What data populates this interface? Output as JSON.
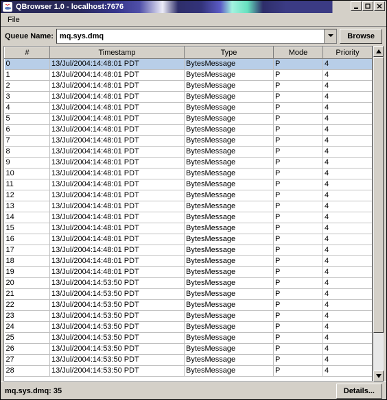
{
  "window": {
    "title": "QBrowser 1.0 - localhost:7676"
  },
  "menu": {
    "file": "File"
  },
  "toolbar": {
    "queue_label": "Queue Name:",
    "queue_value": "mq.sys.dmq",
    "browse_label": "Browse"
  },
  "columns": {
    "num": "#",
    "timestamp": "Timestamp",
    "type": "Type",
    "mode": "Mode",
    "priority": "Priority"
  },
  "rows": [
    {
      "n": "0",
      "ts": "13/Jul/2004:14:48:01 PDT",
      "type": "BytesMessage",
      "mode": "P",
      "prio": "4",
      "sel": true
    },
    {
      "n": "1",
      "ts": "13/Jul/2004:14:48:01 PDT",
      "type": "BytesMessage",
      "mode": "P",
      "prio": "4"
    },
    {
      "n": "2",
      "ts": "13/Jul/2004:14:48:01 PDT",
      "type": "BytesMessage",
      "mode": "P",
      "prio": "4"
    },
    {
      "n": "3",
      "ts": "13/Jul/2004:14:48:01 PDT",
      "type": "BytesMessage",
      "mode": "P",
      "prio": "4"
    },
    {
      "n": "4",
      "ts": "13/Jul/2004:14:48:01 PDT",
      "type": "BytesMessage",
      "mode": "P",
      "prio": "4"
    },
    {
      "n": "5",
      "ts": "13/Jul/2004:14:48:01 PDT",
      "type": "BytesMessage",
      "mode": "P",
      "prio": "4"
    },
    {
      "n": "6",
      "ts": "13/Jul/2004:14:48:01 PDT",
      "type": "BytesMessage",
      "mode": "P",
      "prio": "4"
    },
    {
      "n": "7",
      "ts": "13/Jul/2004:14:48:01 PDT",
      "type": "BytesMessage",
      "mode": "P",
      "prio": "4"
    },
    {
      "n": "8",
      "ts": "13/Jul/2004:14:48:01 PDT",
      "type": "BytesMessage",
      "mode": "P",
      "prio": "4"
    },
    {
      "n": "9",
      "ts": "13/Jul/2004:14:48:01 PDT",
      "type": "BytesMessage",
      "mode": "P",
      "prio": "4"
    },
    {
      "n": "10",
      "ts": "13/Jul/2004:14:48:01 PDT",
      "type": "BytesMessage",
      "mode": "P",
      "prio": "4"
    },
    {
      "n": "11",
      "ts": "13/Jul/2004:14:48:01 PDT",
      "type": "BytesMessage",
      "mode": "P",
      "prio": "4"
    },
    {
      "n": "12",
      "ts": "13/Jul/2004:14:48:01 PDT",
      "type": "BytesMessage",
      "mode": "P",
      "prio": "4"
    },
    {
      "n": "13",
      "ts": "13/Jul/2004:14:48:01 PDT",
      "type": "BytesMessage",
      "mode": "P",
      "prio": "4"
    },
    {
      "n": "14",
      "ts": "13/Jul/2004:14:48:01 PDT",
      "type": "BytesMessage",
      "mode": "P",
      "prio": "4"
    },
    {
      "n": "15",
      "ts": "13/Jul/2004:14:48:01 PDT",
      "type": "BytesMessage",
      "mode": "P",
      "prio": "4"
    },
    {
      "n": "16",
      "ts": "13/Jul/2004:14:48:01 PDT",
      "type": "BytesMessage",
      "mode": "P",
      "prio": "4"
    },
    {
      "n": "17",
      "ts": "13/Jul/2004:14:48:01 PDT",
      "type": "BytesMessage",
      "mode": "P",
      "prio": "4"
    },
    {
      "n": "18",
      "ts": "13/Jul/2004:14:48:01 PDT",
      "type": "BytesMessage",
      "mode": "P",
      "prio": "4"
    },
    {
      "n": "19",
      "ts": "13/Jul/2004:14:48:01 PDT",
      "type": "BytesMessage",
      "mode": "P",
      "prio": "4"
    },
    {
      "n": "20",
      "ts": "13/Jul/2004:14:53:50 PDT",
      "type": "BytesMessage",
      "mode": "P",
      "prio": "4"
    },
    {
      "n": "21",
      "ts": "13/Jul/2004:14:53:50 PDT",
      "type": "BytesMessage",
      "mode": "P",
      "prio": "4"
    },
    {
      "n": "22",
      "ts": "13/Jul/2004:14:53:50 PDT",
      "type": "BytesMessage",
      "mode": "P",
      "prio": "4"
    },
    {
      "n": "23",
      "ts": "13/Jul/2004:14:53:50 PDT",
      "type": "BytesMessage",
      "mode": "P",
      "prio": "4"
    },
    {
      "n": "24",
      "ts": "13/Jul/2004:14:53:50 PDT",
      "type": "BytesMessage",
      "mode": "P",
      "prio": "4"
    },
    {
      "n": "25",
      "ts": "13/Jul/2004:14:53:50 PDT",
      "type": "BytesMessage",
      "mode": "P",
      "prio": "4"
    },
    {
      "n": "26",
      "ts": "13/Jul/2004:14:53:50 PDT",
      "type": "BytesMessage",
      "mode": "P",
      "prio": "4"
    },
    {
      "n": "27",
      "ts": "13/Jul/2004:14:53:50 PDT",
      "type": "BytesMessage",
      "mode": "P",
      "prio": "4"
    },
    {
      "n": "28",
      "ts": "13/Jul/2004:14:53:50 PDT",
      "type": "BytesMessage",
      "mode": "P",
      "prio": "4"
    }
  ],
  "status": {
    "text": "mq.sys.dmq: 35",
    "details_label": "Details..."
  }
}
